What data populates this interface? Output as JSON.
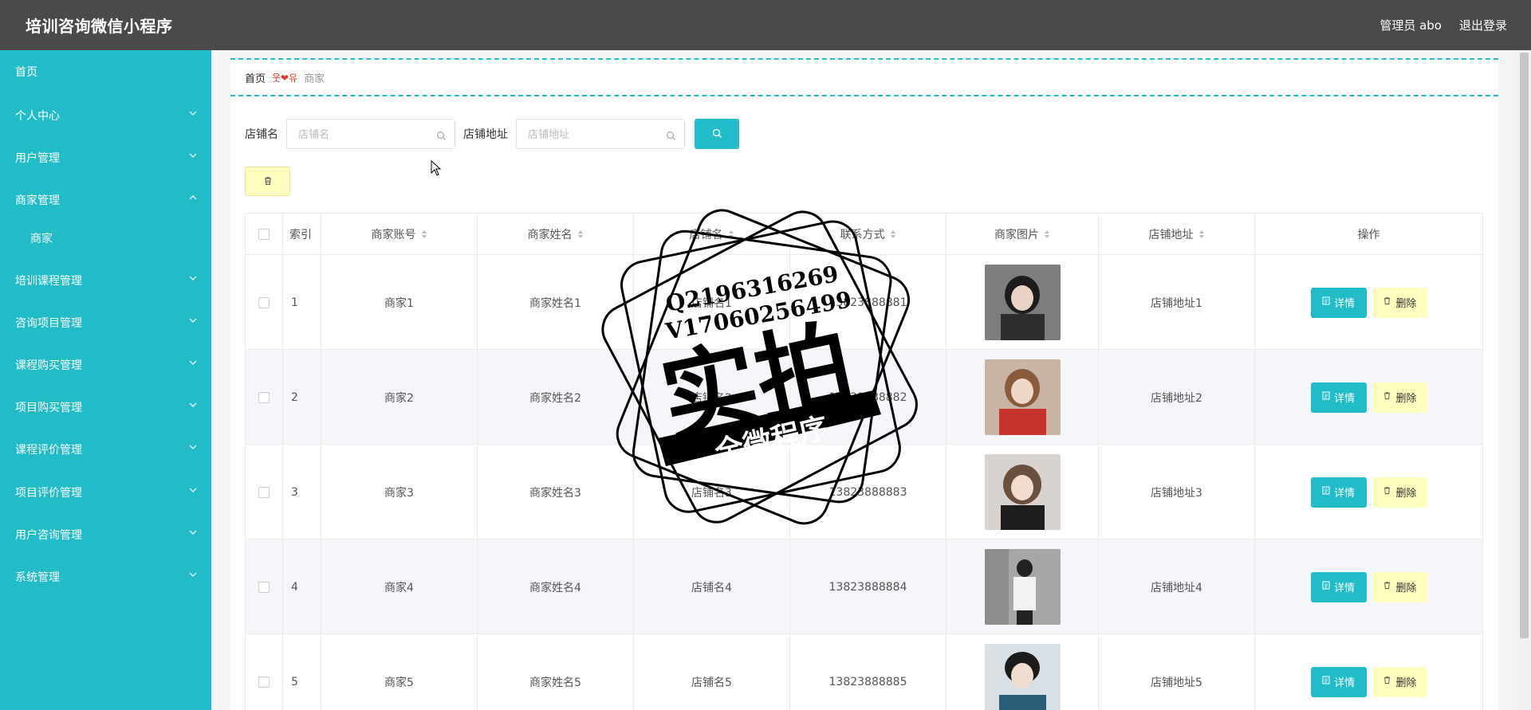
{
  "header": {
    "title": "培训咨询微信小程序",
    "admin_label": "管理员 abo",
    "logout_label": "退出登录"
  },
  "sidebar": {
    "items": [
      {
        "label": "首页",
        "expandable": false
      },
      {
        "label": "个人中心",
        "expandable": true
      },
      {
        "label": "用户管理",
        "expandable": true
      },
      {
        "label": "商家管理",
        "expandable": true,
        "expanded": true
      },
      {
        "label": "商家",
        "expandable": false,
        "sub": true
      },
      {
        "label": "培训课程管理",
        "expandable": true
      },
      {
        "label": "咨询项目管理",
        "expandable": true
      },
      {
        "label": "课程购买管理",
        "expandable": true
      },
      {
        "label": "项目购买管理",
        "expandable": true
      },
      {
        "label": "课程评价管理",
        "expandable": true
      },
      {
        "label": "项目评价管理",
        "expandable": true
      },
      {
        "label": "用户咨询管理",
        "expandable": true
      },
      {
        "label": "系统管理",
        "expandable": true
      }
    ]
  },
  "breadcrumb": {
    "home": "首页",
    "separator": "웃❤유",
    "current": "商家"
  },
  "search": {
    "shop_name_label": "店铺名",
    "shop_name_placeholder": "店铺名",
    "shop_address_label": "店铺地址",
    "shop_address_placeholder": "店铺地址"
  },
  "table": {
    "headers": [
      "索引",
      "商家账号",
      "商家姓名",
      "店铺名",
      "联系方式",
      "商家图片",
      "店铺地址",
      "操作"
    ],
    "rows": [
      {
        "index": "1",
        "account": "商家1",
        "name": "商家姓名1",
        "shop": "店铺名1",
        "phone": "13823888881",
        "address": "店铺地址1"
      },
      {
        "index": "2",
        "account": "商家2",
        "name": "商家姓名2",
        "shop": "店铺名2",
        "phone": "13823888882",
        "address": "店铺地址2"
      },
      {
        "index": "3",
        "account": "商家3",
        "name": "商家姓名3",
        "shop": "店铺名3",
        "phone": "13823888883",
        "address": "店铺地址3"
      },
      {
        "index": "4",
        "account": "商家4",
        "name": "商家姓名4",
        "shop": "店铺名4",
        "phone": "13823888884",
        "address": "店铺地址4"
      },
      {
        "index": "5",
        "account": "商家5",
        "name": "商家姓名5",
        "shop": "店铺名5",
        "phone": "13823888885",
        "address": "店铺地址5"
      }
    ],
    "detail_label": "详情",
    "delete_label": "删除"
  },
  "watermark": {
    "line1": "Q2196316269",
    "line2": "V17060256499",
    "main": "实拍",
    "ribbon": "全微程序"
  },
  "colors": {
    "accent": "#22bcc9",
    "header_bg": "#4a4a4a",
    "delete_bg": "#ffffc0"
  }
}
